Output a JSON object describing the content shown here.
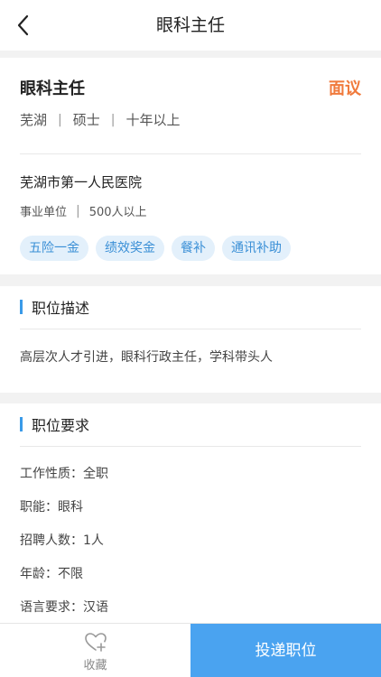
{
  "nav": {
    "title": "眼科主任",
    "back_icon": "chevron-left-icon"
  },
  "job": {
    "title": "眼科主任",
    "salary": "面议",
    "location": "芜湖",
    "education": "硕士",
    "experience": "十年以上"
  },
  "company": {
    "name": "芜湖市第一人民医院",
    "type": "事业单位",
    "size": "500人以上"
  },
  "tags": [
    "五险一金",
    "绩效奖金",
    "餐补",
    "通讯补助"
  ],
  "description": {
    "heading": "职位描述",
    "text": "高层次人才引进，眼科行政主任，学科带头人"
  },
  "requirements": {
    "heading": "职位要求",
    "items": [
      "工作性质：全职",
      "职能：眼科",
      "招聘人数：1人",
      "年龄：不限",
      "语言要求：汉语"
    ]
  },
  "bottom": {
    "favorite_label": "收藏",
    "favorite_icon": "heart-plus-icon",
    "apply_label": "投递职位"
  },
  "colors": {
    "accent": "#4aa3f0",
    "salary": "#f07a3c",
    "tag_bg": "#e3f0fb",
    "tag_text": "#3a8fd6"
  }
}
